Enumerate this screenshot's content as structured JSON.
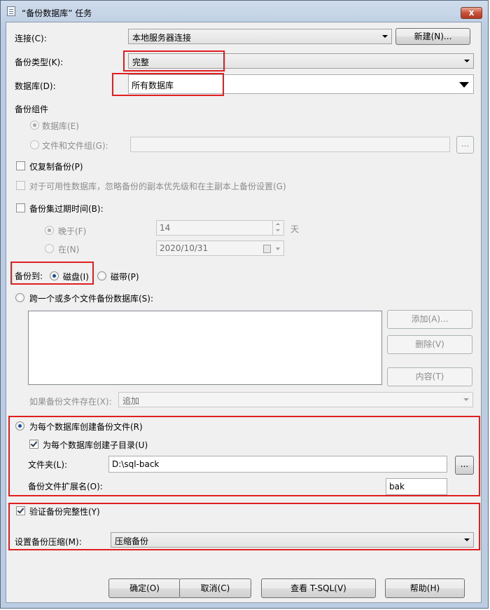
{
  "window": {
    "title": "“备份数据库” 任务",
    "close_label": "x"
  },
  "connection": {
    "label": "连接(C):",
    "value": "本地服务器连接",
    "new_button": "新建(N)..."
  },
  "backup_type": {
    "label": "备份类型(K):",
    "value": "完整"
  },
  "database": {
    "label": "数据库(D):",
    "value": "所有数据库"
  },
  "backup_component": {
    "group_label": "备份组件",
    "database_option": "数据库(E)",
    "files_option": "文件和文件组(G):",
    "browse_label": "..."
  },
  "copy_only": {
    "label": "仅复制备份(P)"
  },
  "availability": {
    "label": "对于可用性数据库，忽略备份的副本优先级和在主副本上备份设置(G)"
  },
  "expiration": {
    "label": "备份集过期时间(B):",
    "after_label": "晚于(F)",
    "after_value": "14",
    "unit": "天",
    "on_label": "在(N)",
    "on_value": "2020/10/31"
  },
  "backup_to": {
    "label": "备份到:",
    "disk": "磁盘(I)",
    "tape": "磁带(P)"
  },
  "span_files": {
    "label": "跨一个或多个文件备份数据库(S):",
    "add_button": "添加(A)...",
    "remove_button": "删除(V)",
    "content_button": "内容(T)",
    "if_exists_label": "如果备份文件存在(X):",
    "if_exists_value": "追加"
  },
  "per_database": {
    "label": "为每个数据库创建备份文件(R)",
    "subdir_label": "为每个数据库创建子目录(U)",
    "folder_label": "文件夹(L):",
    "folder_value": "D:\\sql-back",
    "browse_label": "...",
    "ext_label": "备份文件扩展名(O):",
    "ext_value": "bak"
  },
  "verify": {
    "label": "验证备份完整性(Y)"
  },
  "compression": {
    "label": "设置备份压缩(M):",
    "value": "压缩备份"
  },
  "footer": {
    "ok": "确定(O)",
    "cancel": "取消(C)",
    "tsql": "查看 T-SQL(V)",
    "help": "帮助(H)"
  },
  "colors": {
    "highlight_box": "#e02020",
    "title_gradient": "#cfdcec",
    "client_bg": "#f0f0f0"
  }
}
